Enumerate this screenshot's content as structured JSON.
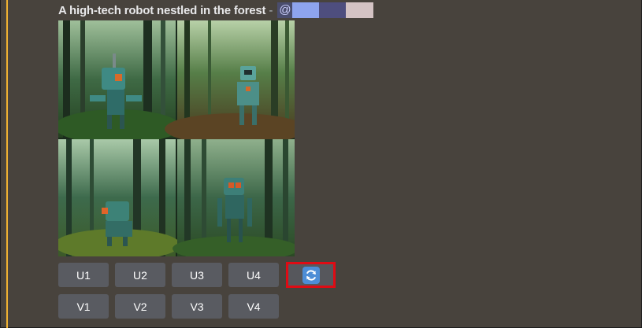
{
  "message": {
    "prompt": "A high-tech robot nestled in the forest",
    "separator": "-",
    "mention_prefix": "@",
    "mention_redaction_colors": [
      "#8ea4ee",
      "#4e4e7e",
      "#d4c3c4"
    ]
  },
  "image_grid": {
    "images": [
      {
        "icon": "robot-forest-image-1"
      },
      {
        "icon": "robot-forest-image-2"
      },
      {
        "icon": "robot-forest-image-3"
      },
      {
        "icon": "robot-forest-image-4"
      }
    ]
  },
  "buttons": {
    "upscale": [
      "U1",
      "U2",
      "U3",
      "U4"
    ],
    "variation": [
      "V1",
      "V2",
      "V3",
      "V4"
    ],
    "reroll_icon": "refresh-icon"
  },
  "colors": {
    "background": "#48433d",
    "button": "#595b61",
    "highlight_bar": "#f0b232",
    "reroll_outline": "#e00b14",
    "reroll_icon_bg": "#4d8dd6"
  }
}
